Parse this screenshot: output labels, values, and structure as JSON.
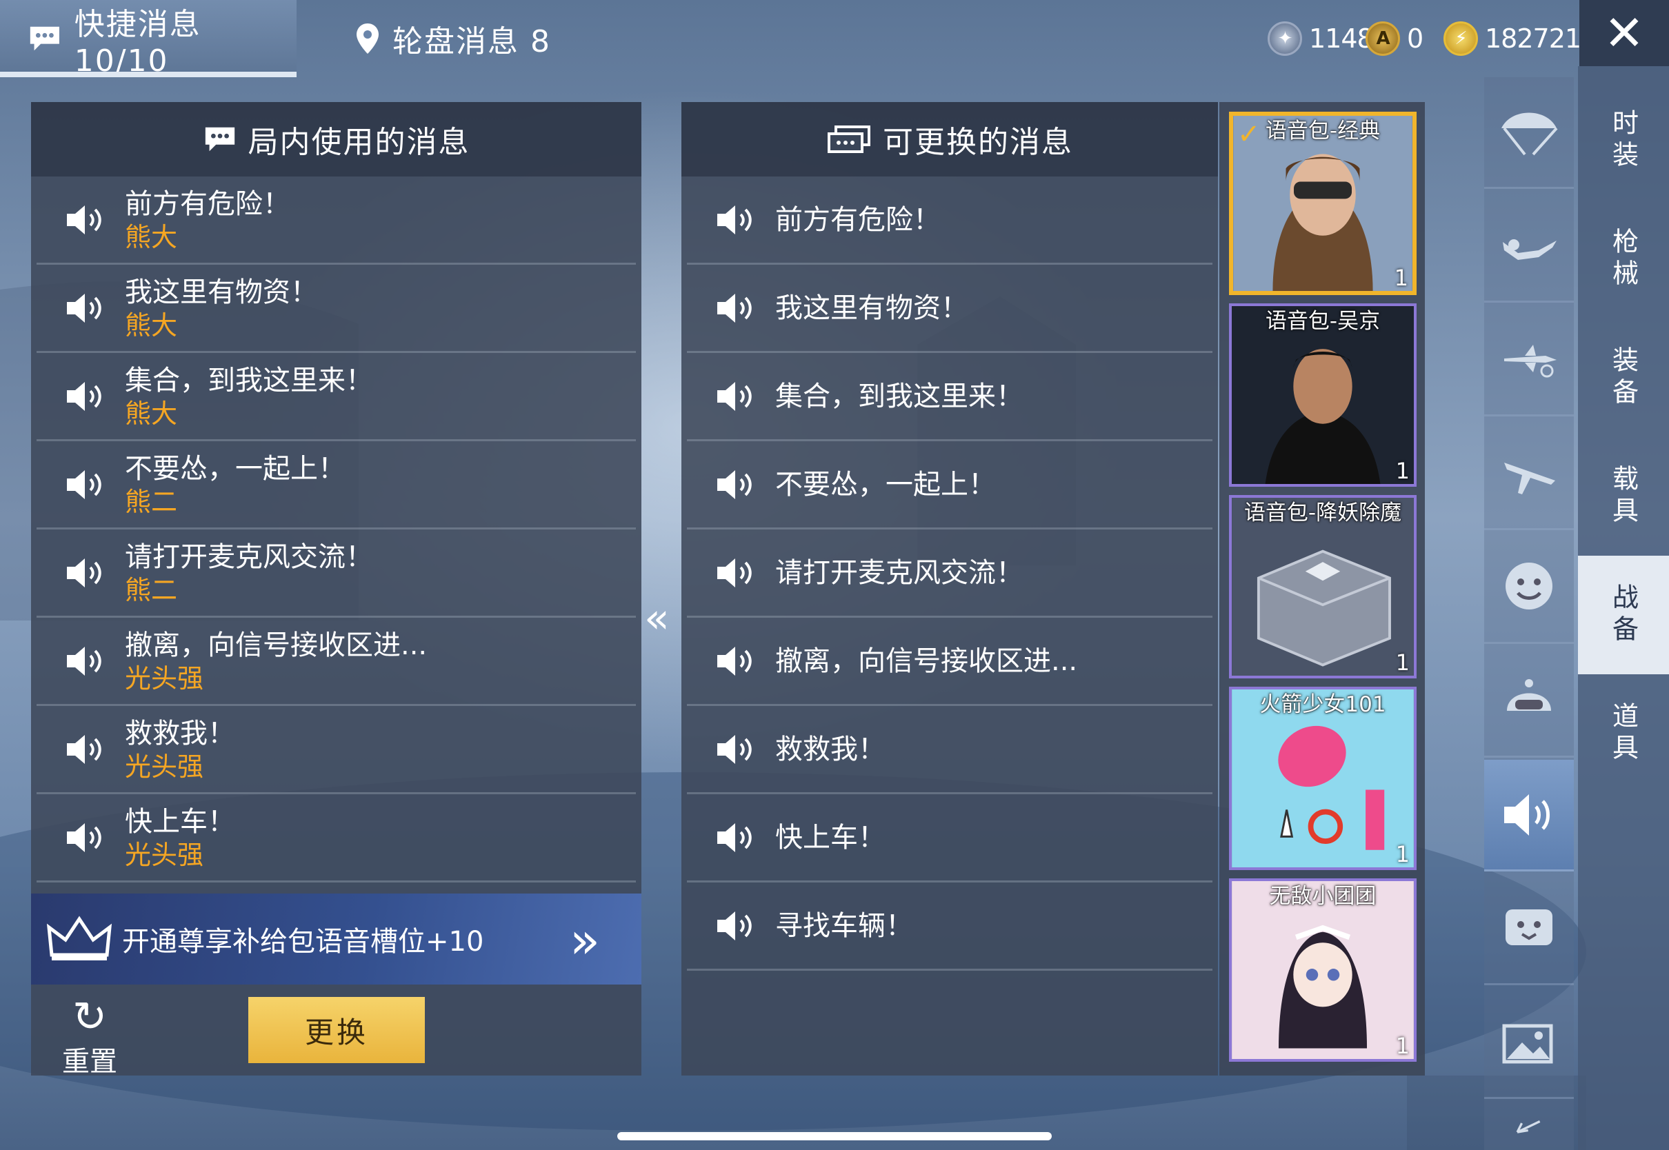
{
  "tabs": {
    "quick_label": "快捷消息 10/10",
    "wheel_label": "轮盘消息 8"
  },
  "currency": {
    "c1": "1148",
    "c2": "0",
    "c3": "182721"
  },
  "left_panel": {
    "title": "局内使用的消息",
    "messages": [
      {
        "text": "前方有危险！",
        "owner": "熊大"
      },
      {
        "text": "我这里有物资！",
        "owner": "熊大"
      },
      {
        "text": "集合，到我这里来！",
        "owner": "熊大"
      },
      {
        "text": "不要怂，一起上！",
        "owner": "熊二"
      },
      {
        "text": "请打开麦克风交流！",
        "owner": "熊二"
      },
      {
        "text": "撤离，向信号接收区进...",
        "owner": "光头强"
      },
      {
        "text": "救救我！",
        "owner": "光头强"
      },
      {
        "text": "快上车！",
        "owner": "光头强"
      }
    ],
    "vip_text": "开通尊享补给包语音槽位+10",
    "reset_label": "重置",
    "replace_label": "更换"
  },
  "right_panel": {
    "title": "可更换的消息",
    "messages": [
      "前方有危险！",
      "我这里有物资！",
      "集合，到我这里来！",
      "不要怂，一起上！",
      "请打开麦克风交流！",
      "撤离，向信号接收区进...",
      "救救我！",
      "快上车！",
      "寻找车辆！"
    ]
  },
  "voice_packs": [
    {
      "title": "语音包-经典",
      "count": "1",
      "selected": true
    },
    {
      "title": "语音包-吴京",
      "count": "1",
      "selected": false
    },
    {
      "title": "语音包-降妖除魔",
      "count": "1",
      "selected": false
    },
    {
      "title": "火箭少女101",
      "count": "1",
      "selected": false
    },
    {
      "title": "无敌小团团",
      "count": "1",
      "selected": false
    }
  ],
  "icon_column": [
    "parachute-icon",
    "skydiver-icon",
    "plane-trail-icon",
    "airplane-icon",
    "emote-face-icon",
    "helmet-icon",
    "voice-speaker-icon",
    "chat-face-icon",
    "photo-icon",
    "back-arrow-icon"
  ],
  "categories": [
    "时装",
    "枪械",
    "装备",
    "载具",
    "战备",
    "道具"
  ],
  "active_category": "战备",
  "colors": {
    "owner_text": "#f5a623",
    "replace_button": "#e9b43c",
    "selected_pack_border": "#f1b52b",
    "pack_border": "#8c78d6"
  }
}
